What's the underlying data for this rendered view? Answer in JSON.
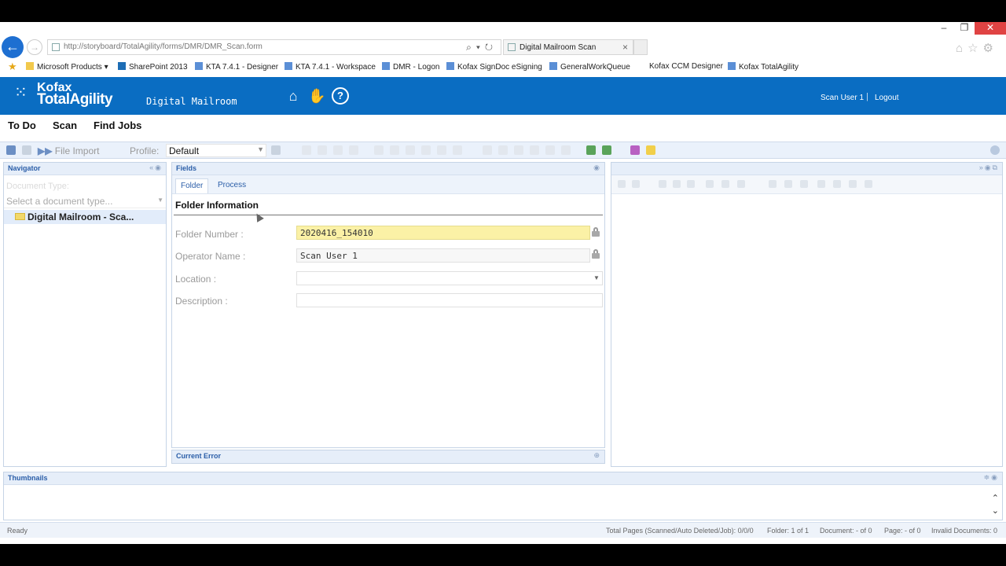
{
  "browser": {
    "url": "http://storyboard/TotalAgility/forms/DMR/DMR_Scan.form",
    "tab_title": "Digital Mailroom Scan",
    "favorites": [
      "Microsoft Products ▾",
      "SharePoint 2013",
      "KTA 7.4.1 - Designer",
      "KTA 7.4.1 - Workspace",
      "DMR - Logon",
      "Kofax SignDoc eSigning",
      "GeneralWorkQueue",
      "Kofax CCM Designer",
      "Kofax TotalAgility"
    ]
  },
  "header": {
    "logo_kofax": "Kofax",
    "logo_product": "TotalAgility",
    "logo_module": "Digital Mailroom",
    "user": "Scan User 1",
    "separator": "|",
    "logout": "Logout"
  },
  "menu": [
    "To Do",
    "Scan",
    "Find Jobs"
  ],
  "toolbar": {
    "file_import": "File Import",
    "profile_label": "Profile:",
    "profile_value": "Default"
  },
  "navigator": {
    "title": "Navigator",
    "doctype_label": "Document Type:",
    "doctype_placeholder": "Select a document type...",
    "tree_node": "Digital Mailroom - Sca..."
  },
  "fields": {
    "title": "Fields",
    "tabs": [
      "Folder",
      "Process"
    ],
    "section": "Folder Information",
    "rows": [
      {
        "label": "Folder Number :",
        "value": "2020416_154010"
      },
      {
        "label": "Operator Name :",
        "value": "Scan User 1"
      },
      {
        "label": "Location :",
        "value": ""
      },
      {
        "label": "Description :",
        "value": ""
      }
    ],
    "current_error": "Current Error"
  },
  "thumbnails": {
    "title": "Thumbnails"
  },
  "status": {
    "ready": "Ready",
    "total_pages": "Total Pages (Scanned/Auto Deleted/Job): 0/0/0",
    "folder": "Folder: 1 of 1",
    "document": "Document: - of 0",
    "page": "Page: - of 0",
    "invalid": "Invalid Documents: 0"
  },
  "colors": {
    "header_bg": "#0a6dc2",
    "locked_field": "#fbf1a6"
  }
}
